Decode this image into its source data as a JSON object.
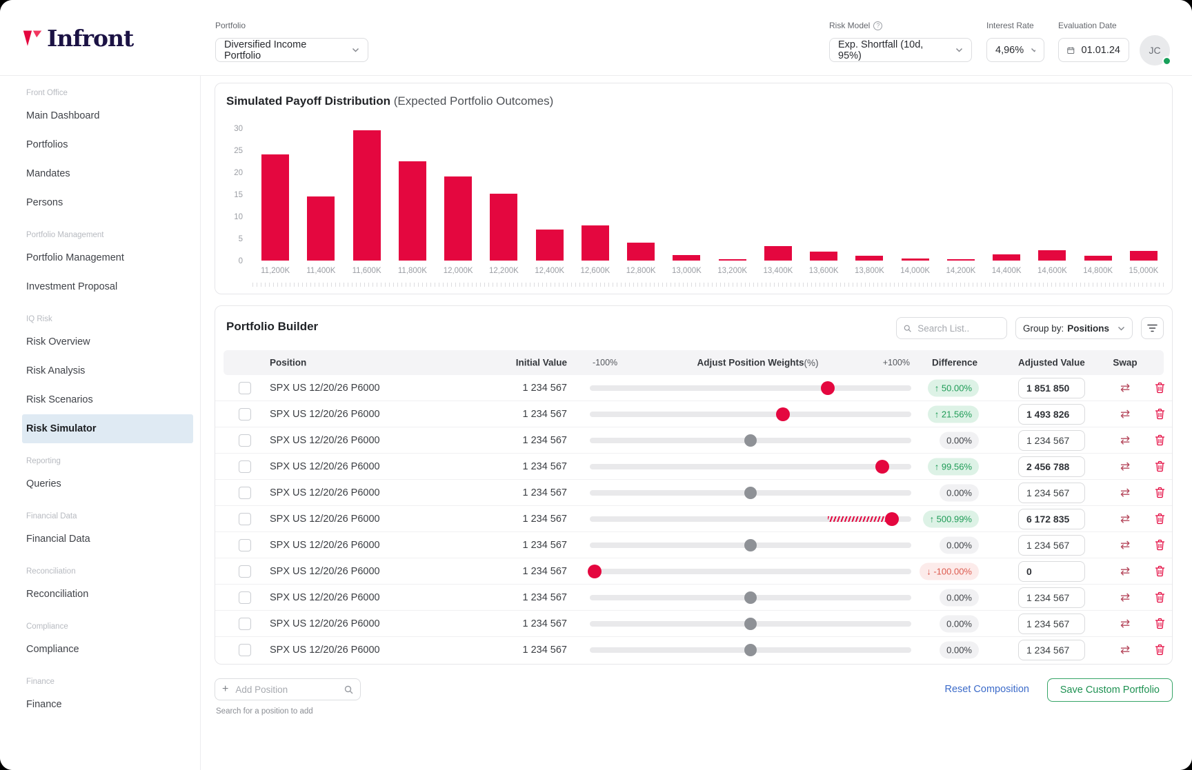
{
  "header": {
    "logo_text": "Infront",
    "portfolio_label": "Portfolio",
    "portfolio_value": "Diversified Income Portfolio",
    "risk_model_label": "Risk Model",
    "risk_model_value": "Exp. Shortfall (10d, 95%)",
    "interest_rate_label": "Interest Rate",
    "interest_rate_value": "4,96%",
    "evaluation_date_label": "Evaluation Date",
    "evaluation_date_value": "01.01.24",
    "avatar_initials": "JC"
  },
  "sidebar": {
    "sections": [
      {
        "label": "Front Office",
        "items": [
          {
            "label": "Main Dashboard"
          },
          {
            "label": "Portfolios"
          },
          {
            "label": "Mandates"
          },
          {
            "label": "Persons"
          }
        ]
      },
      {
        "label": "Portfolio Management",
        "items": [
          {
            "label": "Portfolio Management"
          },
          {
            "label": "Investment Proposal"
          }
        ]
      },
      {
        "label": "IQ Risk",
        "items": [
          {
            "label": "Risk Overview"
          },
          {
            "label": "Risk Analysis"
          },
          {
            "label": "Risk Scenarios"
          },
          {
            "label": "Risk Simulator",
            "active": true
          }
        ]
      },
      {
        "label": "Reporting",
        "items": [
          {
            "label": "Queries"
          }
        ]
      },
      {
        "label": "Financial Data",
        "items": [
          {
            "label": "Financial Data"
          }
        ]
      },
      {
        "label": "Reconciliation",
        "items": [
          {
            "label": "Reconciliation"
          }
        ]
      },
      {
        "label": "Compliance",
        "items": [
          {
            "label": "Compliance"
          }
        ]
      },
      {
        "label": "Finance",
        "items": [
          {
            "label": "Finance"
          }
        ]
      }
    ]
  },
  "chart_data": {
    "type": "bar",
    "title": "Simulated Payoff Distribution",
    "subtitle": "(Expected Portfolio Outcomes)",
    "categories": [
      "11,200K",
      "11,400K",
      "11,600K",
      "11,800K",
      "12,000K",
      "12,200K",
      "12,400K",
      "12,600K",
      "12,800K",
      "13,000K",
      "13,200K",
      "13,400K",
      "13,600K",
      "13,800K",
      "14,000K",
      "14,200K",
      "14,400K",
      "14,600K",
      "14,800K",
      "15,000K"
    ],
    "values": [
      24,
      14.5,
      29.5,
      22.5,
      19,
      15.2,
      7,
      8,
      4,
      1.2,
      0.3,
      3.3,
      2.1,
      1.1,
      0.4,
      0.3,
      1.4,
      2.4,
      1.1,
      2.2
    ],
    "xlabel": "",
    "ylabel": "",
    "ylim": [
      0,
      30
    ],
    "yticks": [
      0,
      5,
      10,
      15,
      20,
      25,
      30
    ],
    "bar_color": "#E4073F",
    "grid": false,
    "legend": "none"
  },
  "builder": {
    "title": "Portfolio Builder",
    "search_placeholder": "Search List..",
    "group_by_label": "Group by:",
    "group_by_value": "Positions",
    "columns": {
      "position": "Position",
      "initial": "Initial Value",
      "min": "-100%",
      "weights": "Adjust Position Weights",
      "weights_unit": "(%)",
      "max": "+100%",
      "difference": "Difference",
      "adjusted": "Adjusted Value",
      "swap": "Swap"
    },
    "rows": [
      {
        "position": "SPX US 12/20/26 P6000",
        "initial": "1 234 567",
        "slider_pct": 74,
        "change": "50.00%",
        "direction": "up",
        "adjusted": "1 851 850",
        "changed": true
      },
      {
        "position": "SPX US 12/20/26 P6000",
        "initial": "1 234 567",
        "slider_pct": 60,
        "change": "21.56%",
        "direction": "up",
        "adjusted": "1 493 826",
        "changed": true
      },
      {
        "position": "SPX US 12/20/26 P6000",
        "initial": "1 234 567",
        "slider_pct": 50,
        "change": "0.00%",
        "direction": "none",
        "adjusted": "1 234 567",
        "changed": false
      },
      {
        "position": "SPX US 12/20/26 P6000",
        "initial": "1 234 567",
        "slider_pct": 91,
        "change": "99.56%",
        "direction": "up",
        "adjusted": "2 456 788",
        "changed": true
      },
      {
        "position": "SPX US 12/20/26 P6000",
        "initial": "1 234 567",
        "slider_pct": 50,
        "change": "0.00%",
        "direction": "none",
        "adjusted": "1 234 567",
        "changed": false
      },
      {
        "position": "SPX US 12/20/26 P6000",
        "initial": "1 234 567",
        "slider_pct": 94,
        "change": "500.99%",
        "direction": "up",
        "adjusted": "6 172 835",
        "changed": true,
        "hatch_from": 74
      },
      {
        "position": "SPX US 12/20/26 P6000",
        "initial": "1 234 567",
        "slider_pct": 50,
        "change": "0.00%",
        "direction": "none",
        "adjusted": "1 234 567",
        "changed": false
      },
      {
        "position": "SPX US 12/20/26 P6000",
        "initial": "1 234 567",
        "slider_pct": 1.5,
        "change": "-100.00%",
        "direction": "down",
        "adjusted": "0",
        "changed": true
      },
      {
        "position": "SPX US 12/20/26 P6000",
        "initial": "1 234 567",
        "slider_pct": 50,
        "change": "0.00%",
        "direction": "none",
        "adjusted": "1 234 567",
        "changed": false
      },
      {
        "position": "SPX US 12/20/26 P6000",
        "initial": "1 234 567",
        "slider_pct": 50,
        "change": "0.00%",
        "direction": "none",
        "adjusted": "1 234 567",
        "changed": false
      },
      {
        "position": "SPX US 12/20/26 P6000",
        "initial": "1 234 567",
        "slider_pct": 50,
        "change": "0.00%",
        "direction": "none",
        "adjusted": "1 234 567",
        "changed": false
      }
    ],
    "add_position_placeholder": "Add Position",
    "add_position_help": "Search for a position to add",
    "reset_label": "Reset Composition",
    "save_label": "Save Custom Portfolio"
  },
  "colors": {
    "brand_red": "#E4073F",
    "logo_navy": "#1B1244",
    "badge_up_bg": "#DDF2E6",
    "badge_up_text": "#1E9B56",
    "badge_down_bg": "#FCEBEA",
    "badge_down_text": "#DC5A4E",
    "badge_neutral_bg": "#F1F1F3",
    "active_nav_bg": "#DFEAF3",
    "link_blue": "#3C6BC9",
    "save_green": "#1E9152",
    "online_dot": "#18A05A"
  }
}
